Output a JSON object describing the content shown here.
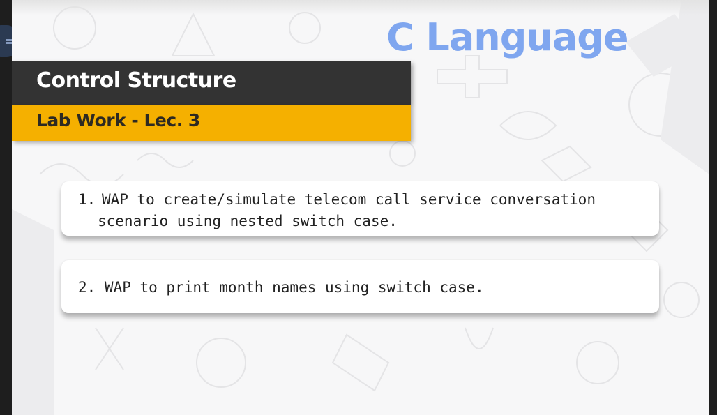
{
  "slide": {
    "heading": "C Language",
    "section_title": "Control Structure",
    "subtitle": "Lab Work - Lec.  3"
  },
  "tasks": [
    {
      "number": "1.",
      "line1": "WAP to create/simulate telecom call service conversation",
      "line2": "scenario using nested switch case."
    },
    {
      "text": "2. WAP to print month names using switch case."
    }
  ],
  "colors": {
    "heading": "#7fa6ef",
    "section_band": "#333333",
    "subtitle_band": "#f5b000",
    "background": "#f7f7f8"
  },
  "icons": {
    "app_icon": "document-icon"
  }
}
